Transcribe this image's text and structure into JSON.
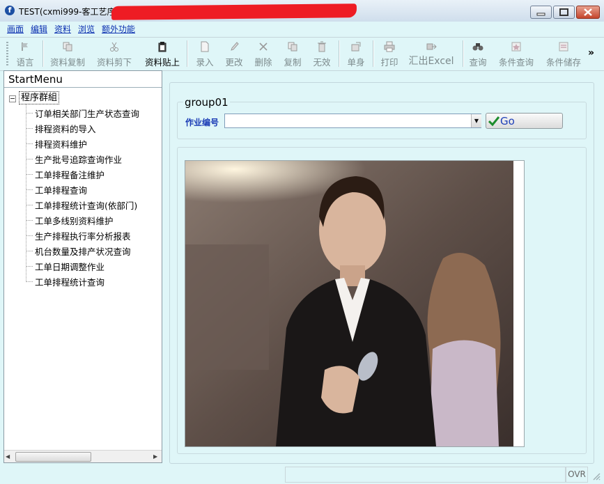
{
  "window": {
    "title_visible": "TEST(cxmi999-客工艺序",
    "app_icon": "f",
    "redaction_color": "#ee1c24"
  },
  "menu": [
    "画面",
    "编辑",
    "资料",
    "浏览",
    "额外功能"
  ],
  "toolbar": {
    "buttons": [
      {
        "label": "语言",
        "icon": "flag-icon",
        "active": false
      },
      {
        "label": "资料复制",
        "icon": "copy-data-icon",
        "active": false
      },
      {
        "label": "资料剪下",
        "icon": "scissors-icon",
        "active": false
      },
      {
        "label": "资料贴上",
        "icon": "clipboard-icon",
        "active": true
      },
      {
        "label": "录入",
        "icon": "new-document-icon",
        "active": false
      },
      {
        "label": "更改",
        "icon": "pencil-icon",
        "active": false
      },
      {
        "label": "删除",
        "icon": "x-icon",
        "active": false
      },
      {
        "label": "复制",
        "icon": "copy-icon",
        "active": false
      },
      {
        "label": "无效",
        "icon": "trash-icon",
        "active": false
      },
      {
        "label": "单身",
        "icon": "detail-icon",
        "active": false
      },
      {
        "label": "打印",
        "icon": "printer-icon",
        "active": false
      },
      {
        "label": "汇出Excel",
        "icon": "export-icon",
        "active": false
      },
      {
        "label": "查询",
        "icon": "binoculars-icon",
        "active": false
      },
      {
        "label": "条件查询",
        "icon": "condition-query-icon",
        "active": false
      },
      {
        "label": "条件储存",
        "icon": "condition-save-icon",
        "active": false
      }
    ],
    "more_label": "»"
  },
  "sidebar": {
    "title": "StartMenu",
    "root_label": "程序群組",
    "items": [
      "订单相关部门生产状态查询",
      "排程资料的导入",
      "排程资料维护",
      "生产批号追踪查询作业",
      "工单排程备注维护",
      "工单排程查询",
      "工单排程统计查询(依部门)",
      "工单多线别资料维护",
      "生产排程执行率分析报表",
      "机台数量及排产状况查询",
      "工单日期调整作业",
      "工单排程统计查询"
    ]
  },
  "form": {
    "group_title": "group01",
    "job_label": "作业编号",
    "job_value": "",
    "go_label": "Go"
  },
  "status": {
    "ovr": "OVR"
  }
}
